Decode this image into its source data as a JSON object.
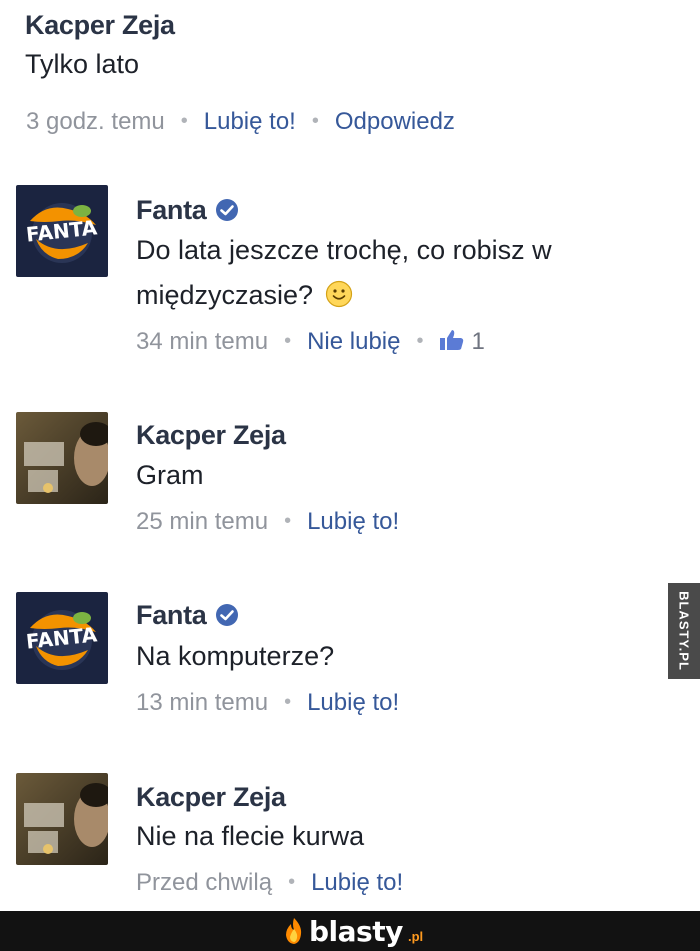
{
  "comments": [
    {
      "author": "Kacper Zeja",
      "lines": [
        "Tylko lato"
      ],
      "time": "3 godz. temu",
      "actions": [
        "Lubię to!",
        "Odpowiedz"
      ]
    },
    {
      "author": "Fanta",
      "verified": true,
      "avatar": "fanta-logo",
      "lines": [
        "Do lata jeszcze trochę, co robisz w",
        "międzyczasie?"
      ],
      "emoji": "smile-emoji",
      "time": "34 min temu",
      "actions": [
        "Nie lubię"
      ],
      "likes": "1"
    },
    {
      "author": "Kacper Zeja",
      "avatar": "user-photo",
      "lines": [
        "Gram"
      ],
      "time": "25 min temu",
      "actions": [
        "Lubię to!"
      ]
    },
    {
      "author": "Fanta",
      "verified": true,
      "avatar": "fanta-logo",
      "lines": [
        "Na komputerze?"
      ],
      "time": "13 min temu",
      "actions": [
        "Lubię to!"
      ]
    },
    {
      "author": "Kacper Zeja",
      "avatar": "user-photo",
      "lines": [
        "Nie na flecie kurwa"
      ],
      "time": "Przed chwilą",
      "actions": [
        "Lubię to!"
      ]
    }
  ],
  "watermark": {
    "side": "BLASTY.PL",
    "brand": "blasty",
    "tld": ".pl"
  },
  "colors": {
    "link": "#365899",
    "meta": "#90949c",
    "verified": "#4267b2"
  }
}
